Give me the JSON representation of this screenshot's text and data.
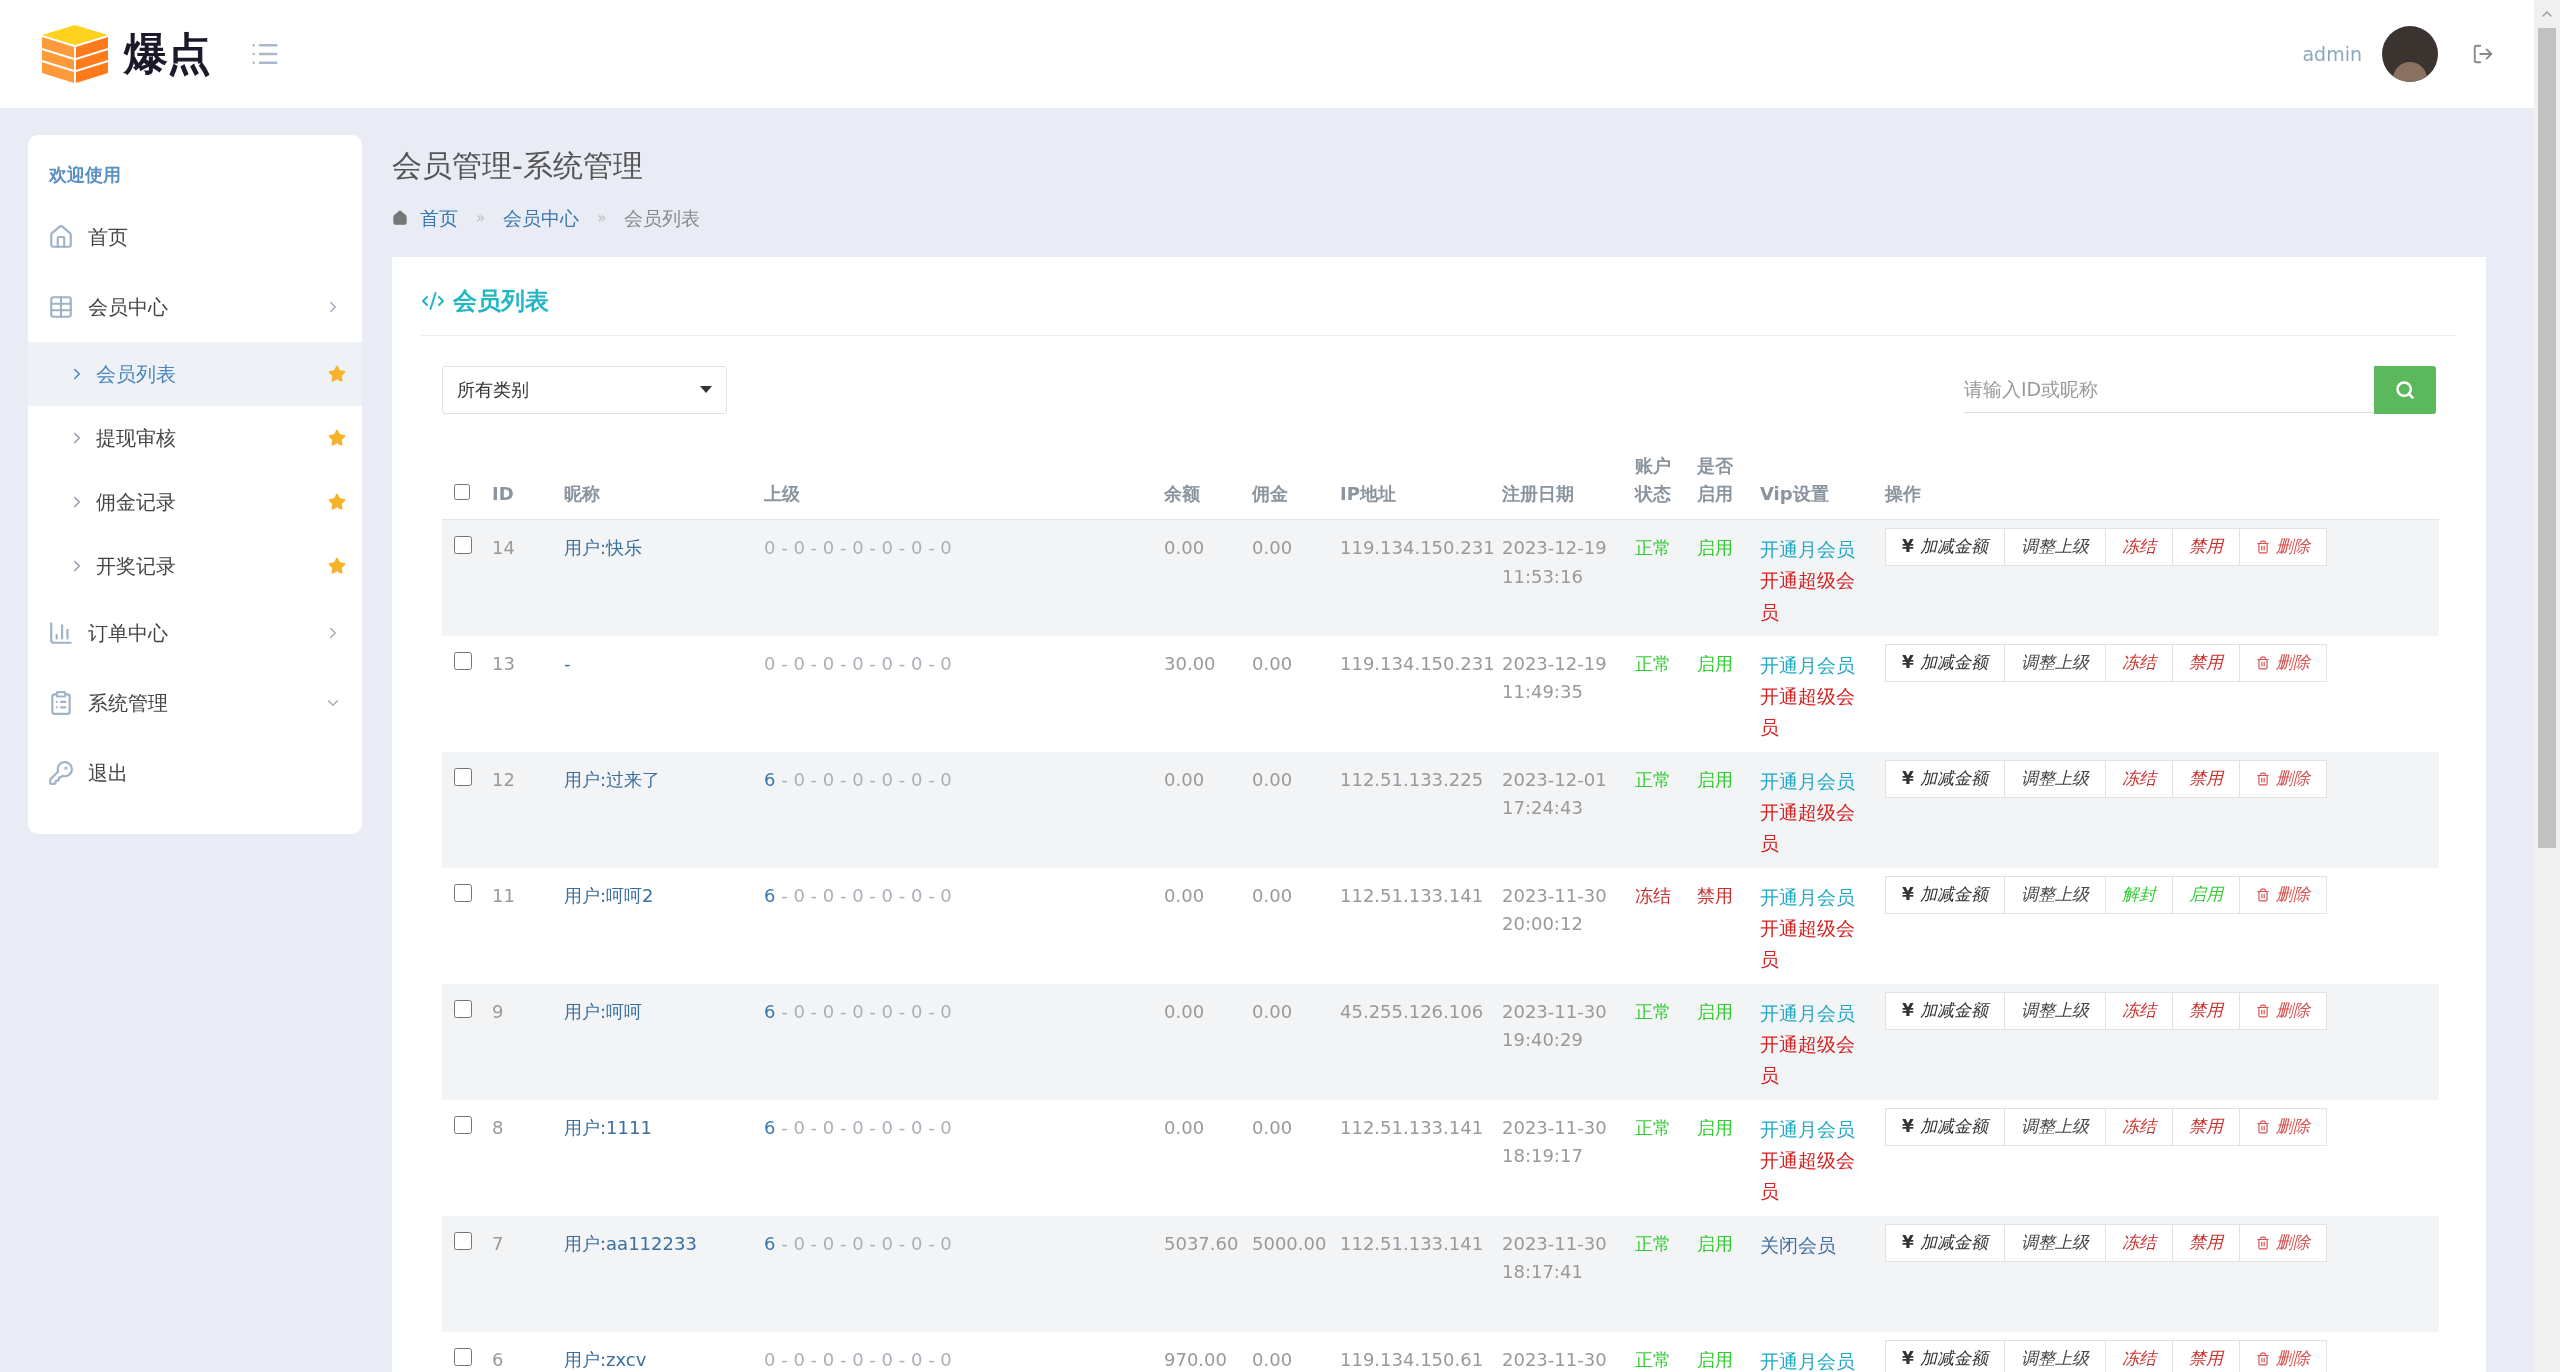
{
  "header": {
    "logo_text": "爆点",
    "user": "admin"
  },
  "sidebar": {
    "welcome": "欢迎使用",
    "items": [
      {
        "label": "首页",
        "kind": "link"
      },
      {
        "label": "会员中心",
        "kind": "group",
        "expanded": false,
        "children": [
          {
            "label": "会员列表",
            "selected": true
          },
          {
            "label": "提现审核",
            "selected": false
          },
          {
            "label": "佣金记录",
            "selected": false
          },
          {
            "label": "开奖记录",
            "selected": false
          }
        ]
      },
      {
        "label": "订单中心",
        "kind": "group",
        "expanded": false
      },
      {
        "label": "系统管理",
        "kind": "group",
        "expanded": true
      },
      {
        "label": "退出",
        "kind": "link"
      }
    ]
  },
  "page": {
    "title": "会员管理-系统管理",
    "breadcrumb": [
      {
        "label": "首页",
        "kind": "link"
      },
      {
        "label": "会员中心",
        "kind": "link"
      },
      {
        "label": "会员列表",
        "kind": "current"
      }
    ],
    "separator": "»"
  },
  "card": {
    "title": "会员列表",
    "filter": {
      "value": "所有类别"
    },
    "search": {
      "placeholder": "请输入ID或昵称"
    }
  },
  "table": {
    "header_checked": false,
    "columns": [
      "ID",
      "昵称",
      "上级",
      "余额",
      "佣金",
      "IP地址",
      "注册日期",
      "账户状态",
      "是否启用",
      "Vip设置",
      "操作"
    ],
    "rows": [
      {
        "checked": false,
        "id": "14",
        "nickname": "用户:快乐",
        "parent": {
          "tail": "0 - 0 - 0 - 0 - 0 - 0 - 0"
        },
        "balance": "0.00",
        "commission": "0.00",
        "ip": "119.134.150.231",
        "date": "2023-12-19",
        "time": "11:53:16",
        "status": {
          "text": "正常",
          "kind": "ok"
        },
        "enabled": {
          "text": "启用",
          "kind": "ok"
        },
        "vip": [
          {
            "text": "开通月会员",
            "kind": "monthly"
          },
          {
            "text": "开通超级会员",
            "kind": "super"
          }
        ],
        "actions": [
          {
            "symbol": "¥",
            "label": "加减金额",
            "kind": "money"
          },
          {
            "label": "调整上级",
            "kind": "plain"
          },
          {
            "label": "冻结",
            "kind": "danger"
          },
          {
            "label": "禁用",
            "kind": "danger"
          },
          {
            "label": "删除",
            "kind": "delete"
          }
        ]
      },
      {
        "checked": false,
        "id": "13",
        "nickname": "-",
        "parent": {
          "tail": "0 - 0 - 0 - 0 - 0 - 0 - 0"
        },
        "balance": "30.00",
        "commission": "0.00",
        "ip": "119.134.150.231",
        "date": "2023-12-19",
        "time": "11:49:35",
        "status": {
          "text": "正常",
          "kind": "ok"
        },
        "enabled": {
          "text": "启用",
          "kind": "ok"
        },
        "vip": [
          {
            "text": "开通月会员",
            "kind": "monthly"
          },
          {
            "text": "开通超级会员",
            "kind": "super"
          }
        ],
        "actions": [
          {
            "symbol": "¥",
            "label": "加减金额",
            "kind": "money"
          },
          {
            "label": "调整上级",
            "kind": "plain"
          },
          {
            "label": "冻结",
            "kind": "danger"
          },
          {
            "label": "禁用",
            "kind": "danger"
          },
          {
            "label": "删除",
            "kind": "delete"
          }
        ]
      },
      {
        "checked": false,
        "id": "12",
        "nickname": "用户:过来了",
        "parent": {
          "head": "6",
          "tail": " - 0 - 0 - 0 - 0 - 0 - 0"
        },
        "balance": "0.00",
        "commission": "0.00",
        "ip": "112.51.133.225",
        "date": "2023-12-01",
        "time": "17:24:43",
        "status": {
          "text": "正常",
          "kind": "ok"
        },
        "enabled": {
          "text": "启用",
          "kind": "ok"
        },
        "vip": [
          {
            "text": "开通月会员",
            "kind": "monthly"
          },
          {
            "text": "开通超级会员",
            "kind": "super"
          }
        ],
        "actions": [
          {
            "symbol": "¥",
            "label": "加减金额",
            "kind": "money"
          },
          {
            "label": "调整上级",
            "kind": "plain"
          },
          {
            "label": "冻结",
            "kind": "danger"
          },
          {
            "label": "禁用",
            "kind": "danger"
          },
          {
            "label": "删除",
            "kind": "delete"
          }
        ]
      },
      {
        "checked": false,
        "id": "11",
        "nickname": "用户:呵呵2",
        "parent": {
          "head": "6",
          "tail": " - 0 - 0 - 0 - 0 - 0 - 0"
        },
        "balance": "0.00",
        "commission": "0.00",
        "ip": "112.51.133.141",
        "date": "2023-11-30",
        "time": "20:00:12",
        "status": {
          "text": "冻结",
          "kind": "bad"
        },
        "enabled": {
          "text": "禁用",
          "kind": "bad"
        },
        "vip": [
          {
            "text": "开通月会员",
            "kind": "monthly"
          },
          {
            "text": "开通超级会员",
            "kind": "super"
          }
        ],
        "actions": [
          {
            "symbol": "¥",
            "label": "加减金额",
            "kind": "money"
          },
          {
            "label": "调整上级",
            "kind": "plain"
          },
          {
            "label": "解封",
            "kind": "success"
          },
          {
            "label": "启用",
            "kind": "success"
          },
          {
            "label": "删除",
            "kind": "delete"
          }
        ]
      },
      {
        "checked": false,
        "id": "9",
        "nickname": "用户:呵呵",
        "parent": {
          "head": "6",
          "tail": " - 0 - 0 - 0 - 0 - 0 - 0"
        },
        "balance": "0.00",
        "commission": "0.00",
        "ip": "45.255.126.106",
        "date": "2023-11-30",
        "time": "19:40:29",
        "status": {
          "text": "正常",
          "kind": "ok"
        },
        "enabled": {
          "text": "启用",
          "kind": "ok"
        },
        "vip": [
          {
            "text": "开通月会员",
            "kind": "monthly"
          },
          {
            "text": "开通超级会员",
            "kind": "super"
          }
        ],
        "actions": [
          {
            "symbol": "¥",
            "label": "加减金额",
            "kind": "money"
          },
          {
            "label": "调整上级",
            "kind": "plain"
          },
          {
            "label": "冻结",
            "kind": "danger"
          },
          {
            "label": "禁用",
            "kind": "danger"
          },
          {
            "label": "删除",
            "kind": "delete"
          }
        ]
      },
      {
        "checked": false,
        "id": "8",
        "nickname": "用户:1111",
        "parent": {
          "head": "6",
          "tail": " - 0 - 0 - 0 - 0 - 0 - 0"
        },
        "balance": "0.00",
        "commission": "0.00",
        "ip": "112.51.133.141",
        "date": "2023-11-30",
        "time": "18:19:17",
        "status": {
          "text": "正常",
          "kind": "ok"
        },
        "enabled": {
          "text": "启用",
          "kind": "ok"
        },
        "vip": [
          {
            "text": "开通月会员",
            "kind": "monthly"
          },
          {
            "text": "开通超级会员",
            "kind": "super"
          }
        ],
        "actions": [
          {
            "symbol": "¥",
            "label": "加减金额",
            "kind": "money"
          },
          {
            "label": "调整上级",
            "kind": "plain"
          },
          {
            "label": "冻结",
            "kind": "danger"
          },
          {
            "label": "禁用",
            "kind": "danger"
          },
          {
            "label": "删除",
            "kind": "delete"
          }
        ]
      },
      {
        "checked": false,
        "id": "7",
        "nickname": "用户:aa112233",
        "parent": {
          "head": "6",
          "tail": " - 0 - 0 - 0 - 0 - 0 - 0"
        },
        "balance": "5037.60",
        "commission": "5000.00",
        "ip": "112.51.133.141",
        "date": "2023-11-30",
        "time": "18:17:41",
        "status": {
          "text": "正常",
          "kind": "ok"
        },
        "enabled": {
          "text": "启用",
          "kind": "ok"
        },
        "vip": [
          {
            "text": "关闭会员",
            "kind": "close"
          }
        ],
        "actions": [
          {
            "symbol": "¥",
            "label": "加减金额",
            "kind": "money"
          },
          {
            "label": "调整上级",
            "kind": "plain"
          },
          {
            "label": "冻结",
            "kind": "danger"
          },
          {
            "label": "禁用",
            "kind": "danger"
          },
          {
            "label": "删除",
            "kind": "delete"
          }
        ]
      },
      {
        "checked": false,
        "id": "6",
        "nickname": "用户:zxcv",
        "parent": {
          "tail": "0 - 0 - 0 - 0 - 0 - 0 - 0"
        },
        "balance": "970.00",
        "commission": "0.00",
        "ip": "119.134.150.61",
        "date": "2023-11-30",
        "status": {
          "text": "正常",
          "kind": "ok"
        },
        "enabled": {
          "text": "启用",
          "kind": "ok"
        },
        "vip": [
          {
            "text": "开通月会员",
            "kind": "monthly"
          }
        ],
        "actions": [
          {
            "symbol": "¥",
            "label": "加减金额",
            "kind": "money"
          },
          {
            "label": "调整上级",
            "kind": "plain"
          },
          {
            "label": "冻结",
            "kind": "danger"
          },
          {
            "label": "禁用",
            "kind": "danger"
          },
          {
            "label": "删除",
            "kind": "delete"
          }
        ]
      }
    ]
  }
}
